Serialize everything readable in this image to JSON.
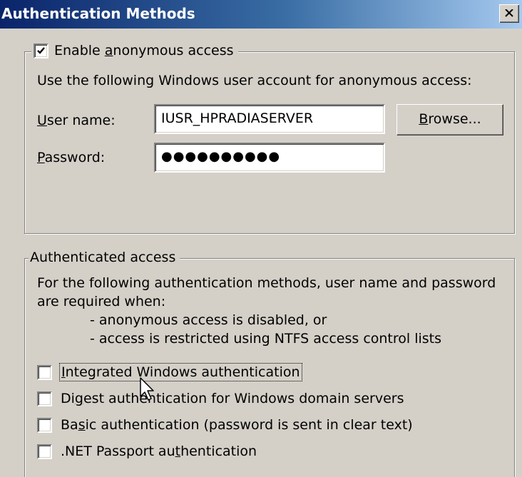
{
  "window": {
    "title": "Authentication Methods",
    "close_icon": "close-x-icon"
  },
  "anonymous": {
    "checkbox": {
      "checked": true,
      "pre": "Enable ",
      "accel": "a",
      "post": "nonymous access"
    },
    "description": "Use the following Windows user account for anonymous access:",
    "username_label": {
      "accel": "U",
      "post": "ser name:"
    },
    "username_value": "IUSR_HPRADIASERVER",
    "browse_button": {
      "accel": "B",
      "post": "rowse..."
    },
    "password_label": {
      "accel": "P",
      "post": "assword:"
    },
    "password_value": "●●●●●●●●●●"
  },
  "authenticated": {
    "legend": "Authenticated access",
    "description_line1": "For the following authentication methods, user name and password",
    "description_line2": "are required when:",
    "condition1": "- anonymous access is disabled, or",
    "condition2": "- access is restricted using NTFS access control lists",
    "options": [
      {
        "checked": false,
        "pre": "",
        "accel": "I",
        "post": "ntegrated Windows authentication",
        "focused": true
      },
      {
        "checked": false,
        "pre": "Di",
        "accel": "g",
        "post": "est authentication for Windows domain servers",
        "focused": false
      },
      {
        "checked": false,
        "pre": "Ba",
        "accel": "s",
        "post": "ic authentication (password is sent in clear text)",
        "focused": false
      },
      {
        "checked": false,
        "pre": ".NET Passport au",
        "accel": "t",
        "post": "hentication",
        "focused": false
      }
    ]
  },
  "colors": {
    "titlebar_start": "#0a246a",
    "titlebar_end": "#a6caf0",
    "dialog_bg": "#d4d0c8"
  }
}
